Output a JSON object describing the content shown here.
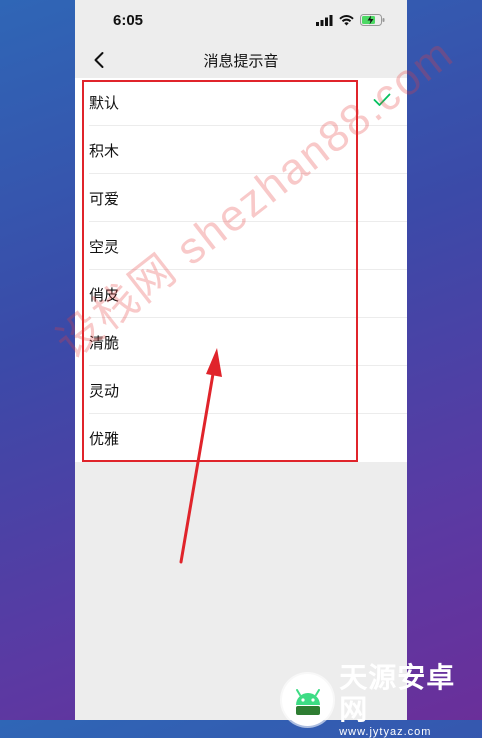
{
  "status_bar": {
    "time": "6:05"
  },
  "nav": {
    "title": "消息提示音"
  },
  "sounds": [
    {
      "label": "默认",
      "selected": true
    },
    {
      "label": "积木",
      "selected": false
    },
    {
      "label": "可爱",
      "selected": false
    },
    {
      "label": "空灵",
      "selected": false
    },
    {
      "label": "俏皮",
      "selected": false
    },
    {
      "label": "清脆",
      "selected": false
    },
    {
      "label": "灵动",
      "selected": false
    },
    {
      "label": "优雅",
      "selected": false
    }
  ],
  "colors": {
    "check": "#07c160",
    "annotation": "#e0242b"
  },
  "watermark": {
    "text": "设栈网 shezhan88.com"
  },
  "brand": {
    "name": "天源安卓网",
    "url": "www.jytyaz.com"
  }
}
